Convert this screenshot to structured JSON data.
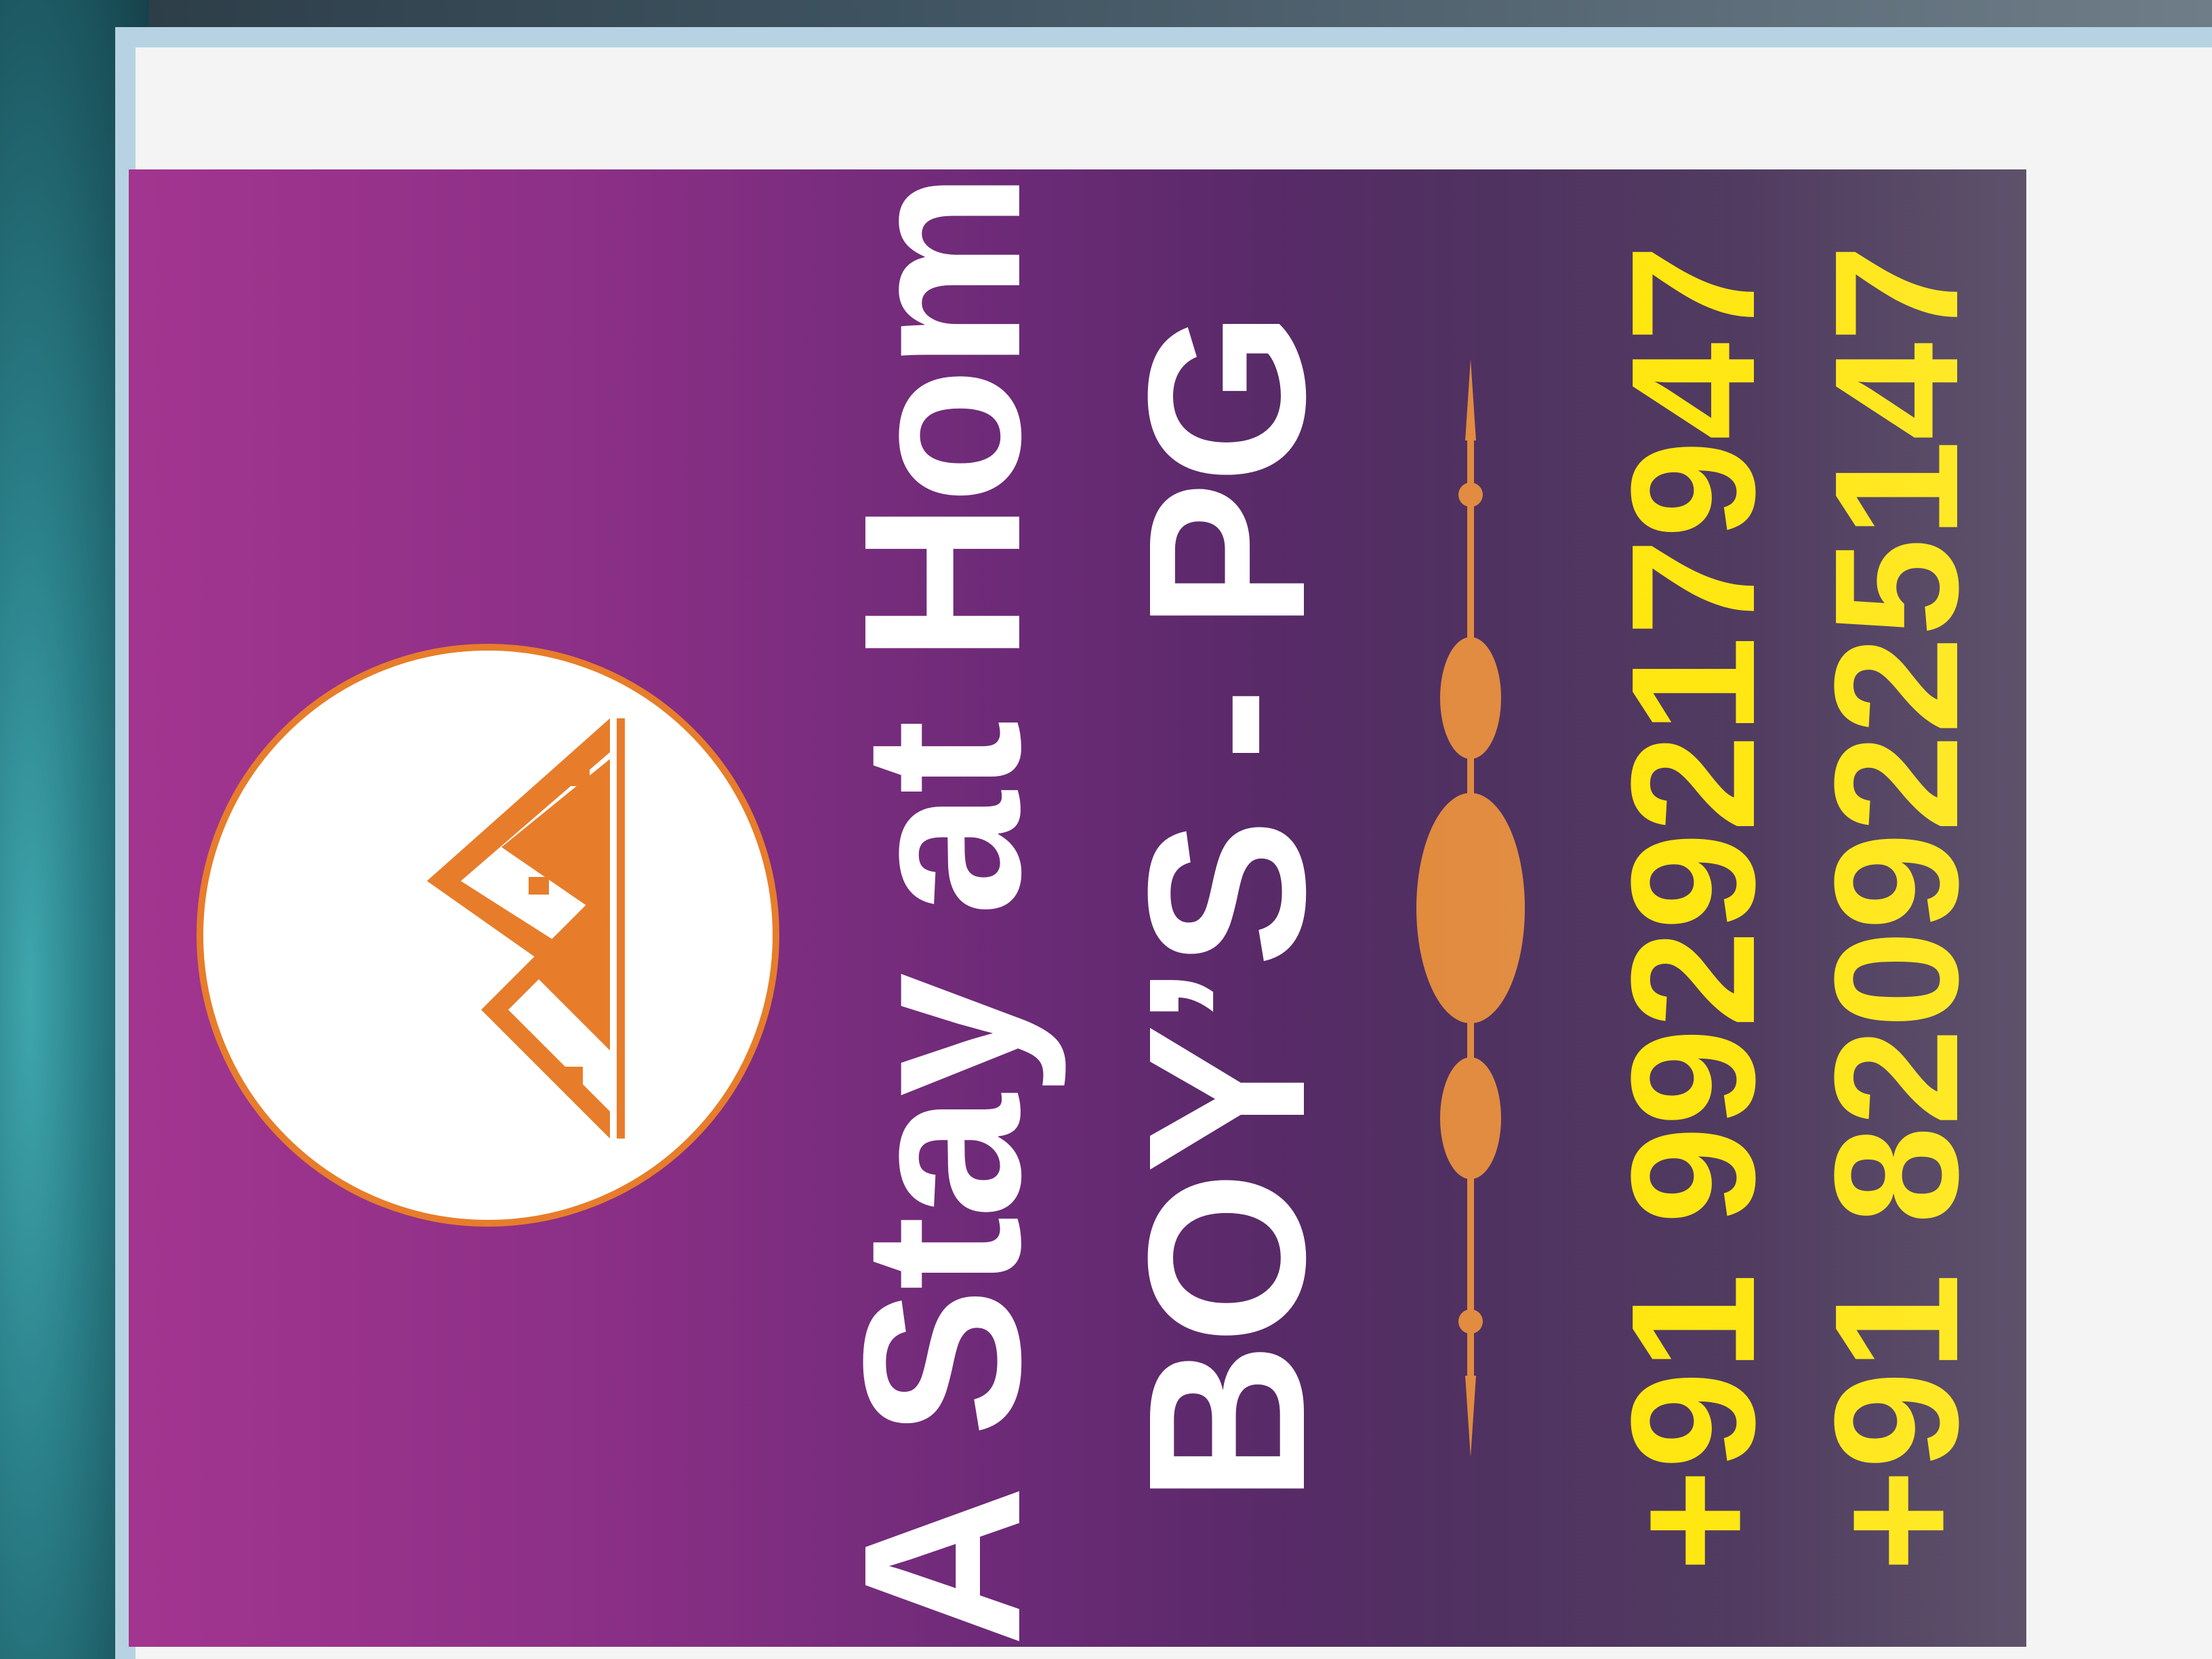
{
  "poster": {
    "title_line_1": "A Stay at Home",
    "title_line_2": "BOY’S - PG",
    "phone_1": "+91 9929217947",
    "phone_2": "+91 8209225147",
    "logo_icon": "house-roof-icon",
    "colors": {
      "background_top": "#a3358f",
      "background_bottom": "#3a2c4a",
      "accent_orange": "#e77d2a",
      "phone_text": "#ffe500",
      "title_text": "#ffffff"
    }
  }
}
